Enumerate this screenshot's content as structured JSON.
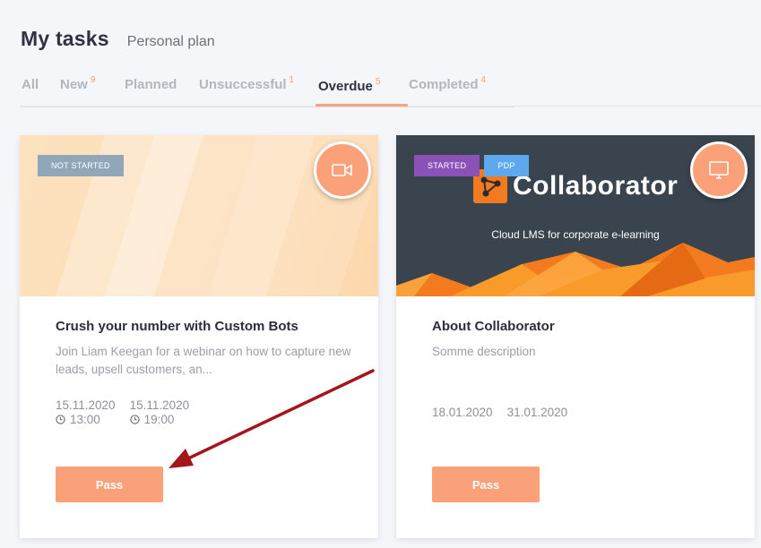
{
  "header": {
    "title": "My tasks",
    "subtitle": "Personal plan"
  },
  "tabs": [
    {
      "label": "All",
      "count": ""
    },
    {
      "label": "New",
      "count": "9"
    },
    {
      "label": "Planned",
      "count": ""
    },
    {
      "label": "Unsuccessful",
      "count": "1"
    },
    {
      "label": "Overdue",
      "count": "5"
    },
    {
      "label": "Completed",
      "count": "4"
    }
  ],
  "active_tab": "Overdue",
  "cards": [
    {
      "badges": [
        "NOT STARTED"
      ],
      "type_icon": "video-camera-icon",
      "title": "Crush your number with Custom Bots",
      "description": "Join Liam Keegan for a webinar on how to capture new leads, upsell customers, an...",
      "start_date": "15.11.2020",
      "start_time": "13:00",
      "end_date": "15.11.2020",
      "end_time": "19:00",
      "button_label": "Pass"
    },
    {
      "badges": [
        "STARTED",
        "PDP"
      ],
      "type_icon": "monitor-icon",
      "banner_logo_text": "Collaborator",
      "banner_tagline": "Cloud LMS for corporate e-learning",
      "title": "About Collaborator",
      "description": "Somme description",
      "start_date": "18.01.2020",
      "end_date": "31.01.2020",
      "button_label": "Pass"
    }
  ],
  "colors": {
    "accent": "#fba179",
    "tab_active_underline": "#f7a57e",
    "badge_not_started": "#8fa7b8",
    "badge_started": "#8a52b6",
    "badge_pdp": "#5ea8ee",
    "annotation_arrow": "#a3161b"
  }
}
